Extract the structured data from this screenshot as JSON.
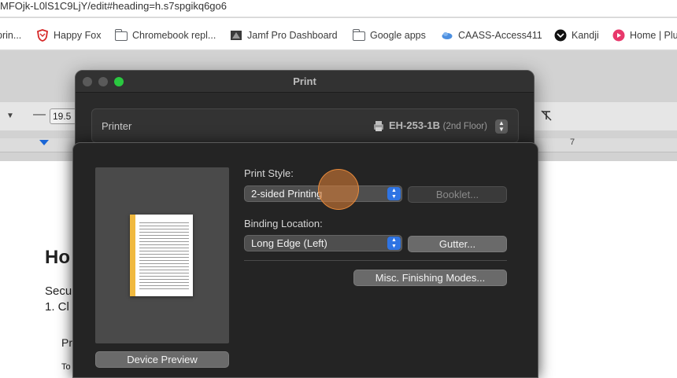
{
  "browser": {
    "url_fragment": "MFOjk-L0lS1C9LjY/edit#heading=h.s7spgikq6go6",
    "bookmarks": [
      {
        "label": "prin...",
        "icon": "cut-off-icon"
      },
      {
        "label": "Happy Fox",
        "icon": "shield-icon"
      },
      {
        "label": "Chromebook repl...",
        "icon": "folder-icon"
      },
      {
        "label": "Jamf Pro Dashboard",
        "icon": "jamf-icon"
      },
      {
        "label": "Google apps",
        "icon": "folder-icon"
      },
      {
        "label": "CAASS-Access411",
        "icon": "cloud-icon"
      },
      {
        "label": "Kandji",
        "icon": "kandji-icon"
      },
      {
        "label": "Home | Plu",
        "icon": "play-icon"
      }
    ]
  },
  "docs": {
    "font_size": "19.5",
    "ruler_number": "7",
    "heading": "Ho",
    "line1": "Secu",
    "line2": "1. Cl",
    "line3": "Pr",
    "line4": "To"
  },
  "print_dialog": {
    "title": "Print",
    "printer_label": "Printer",
    "printer_name": "EH-253-1B",
    "printer_location": "(2nd Floor)"
  },
  "sheet": {
    "print_style_label": "Print Style:",
    "print_style_value": "2-sided Printing",
    "booklet_button": "Booklet...",
    "binding_location_label": "Binding Location:",
    "binding_location_value": "Long Edge (Left)",
    "gutter_button": "Gutter...",
    "misc_button": "Misc. Finishing Modes...",
    "device_preview_button": "Device Preview"
  },
  "colors": {
    "accent_blue": "#2f74e3",
    "binding_edge": "#f0b93f",
    "click_indicator": "#d67c36",
    "zoom_green": "#2ac840"
  }
}
